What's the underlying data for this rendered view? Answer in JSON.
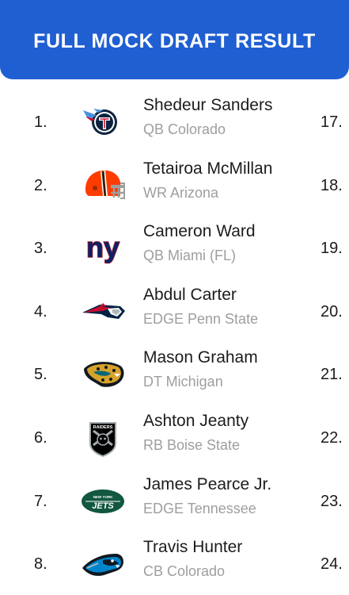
{
  "header": {
    "title": "FULL MOCK DRAFT RESULT"
  },
  "picks": [
    {
      "number": "1.",
      "team_icon": "titans-logo-icon",
      "name": "Shedeur Sanders",
      "info": "QB Colorado",
      "right_number": "17."
    },
    {
      "number": "2.",
      "team_icon": "browns-logo-icon",
      "name": "Tetairoa McMillan",
      "info": "WR Arizona",
      "right_number": "18."
    },
    {
      "number": "3.",
      "team_icon": "giants-logo-icon",
      "name": "Cameron Ward",
      "info": "QB Miami (FL)",
      "right_number": "19."
    },
    {
      "number": "4.",
      "team_icon": "patriots-logo-icon",
      "name": "Abdul Carter",
      "info": "EDGE Penn State",
      "right_number": "20."
    },
    {
      "number": "5.",
      "team_icon": "jaguars-logo-icon",
      "name": "Mason Graham",
      "info": "DT Michigan",
      "right_number": "21."
    },
    {
      "number": "6.",
      "team_icon": "raiders-logo-icon",
      "name": "Ashton Jeanty",
      "info": "RB Boise State",
      "right_number": "22."
    },
    {
      "number": "7.",
      "team_icon": "jets-logo-icon",
      "name": "James Pearce Jr.",
      "info": "EDGE Tennessee",
      "right_number": "23."
    },
    {
      "number": "8.",
      "team_icon": "panthers-logo-icon",
      "name": "Travis Hunter",
      "info": "CB Colorado",
      "right_number": "24."
    }
  ],
  "logo_text": {
    "giants": "ny",
    "raiders": "RAIDERS",
    "jets_top": "NEW YORK",
    "jets": "JETS"
  },
  "colors": {
    "header_bg": "#1f5fd2",
    "header_text": "#ffffff",
    "name_text": "#1c1c1c",
    "info_text": "#9e9e9e"
  }
}
